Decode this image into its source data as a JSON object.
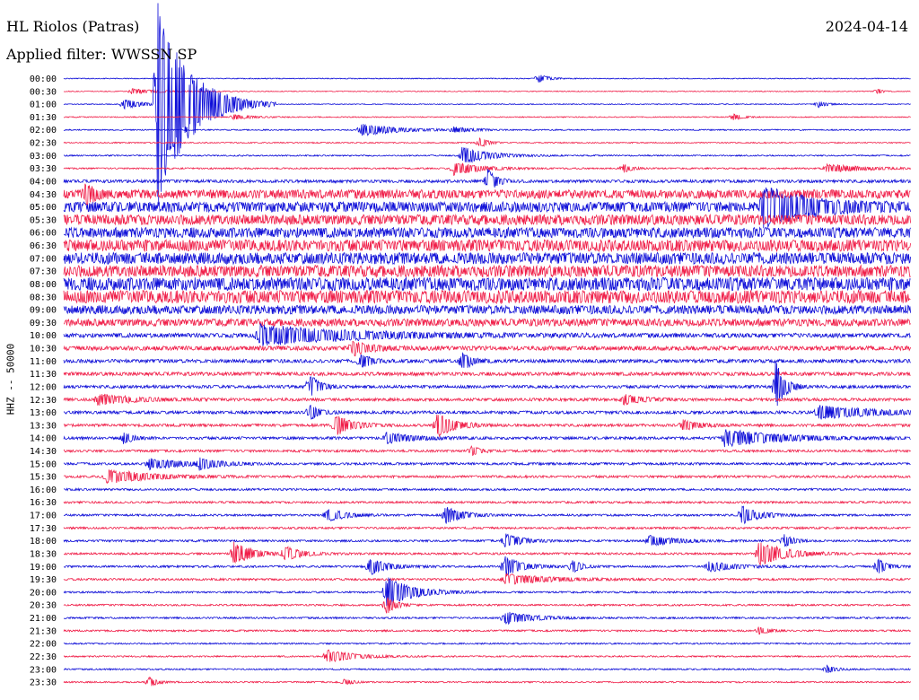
{
  "header": {
    "station": "HL Riolos (Patras)",
    "filter": "Applied filter: WWSSN SP",
    "date": "2024-04-14"
  },
  "chart_data": {
    "type": "line",
    "title": "HL Riolos (Patras)",
    "ylabel": "HHZ -- 50000",
    "xlabel": "",
    "grid": false,
    "row_times": [
      "00:00",
      "00:30",
      "01:00",
      "01:30",
      "02:00",
      "02:30",
      "03:00",
      "03:30",
      "04:00",
      "04:30",
      "05:00",
      "05:30",
      "06:00",
      "06:30",
      "07:00",
      "07:30",
      "08:00",
      "08:30",
      "09:00",
      "09:30",
      "10:00",
      "10:30",
      "11:00",
      "11:30",
      "12:00",
      "12:30",
      "13:00",
      "13:30",
      "14:00",
      "14:30",
      "15:00",
      "15:30",
      "16:00",
      "16:30",
      "17:00",
      "17:30",
      "18:00",
      "18:30",
      "19:00",
      "19:30",
      "20:00",
      "20:30",
      "21:00",
      "21:30",
      "22:00",
      "22:30",
      "23:00",
      "23:30"
    ],
    "colors": [
      "#1010d8",
      "#f0204a"
    ],
    "noise_level": [
      0.3,
      0.3,
      0.3,
      0.35,
      0.4,
      0.4,
      0.45,
      0.5,
      1.0,
      3.0,
      3.5,
      3.5,
      3.5,
      4.0,
      4.0,
      4.0,
      4.5,
      4.5,
      3.0,
      2.5,
      1.5,
      1.5,
      1.2,
      1.2,
      1.0,
      1.0,
      1.0,
      0.9,
      0.9,
      0.8,
      0.8,
      0.8,
      0.7,
      0.7,
      0.7,
      0.7,
      0.7,
      0.7,
      0.7,
      0.7,
      0.6,
      0.6,
      0.6,
      0.6,
      0.5,
      0.5,
      0.5,
      0.5
    ],
    "events": [
      {
        "row": 0,
        "t": 0.56,
        "amp": 6,
        "dur": 0.01
      },
      {
        "row": 1,
        "t": 0.08,
        "amp": 3,
        "dur": 0.03
      },
      {
        "row": 1,
        "t": 0.96,
        "amp": 4,
        "dur": 0.005
      },
      {
        "row": 2,
        "t": 0.07,
        "amp": 6,
        "dur": 0.02
      },
      {
        "row": 2,
        "t": 0.11,
        "amp": 120,
        "dur": 0.035
      },
      {
        "row": 2,
        "t": 0.89,
        "amp": 4,
        "dur": 0.01
      },
      {
        "row": 3,
        "t": 0.2,
        "amp": 3,
        "dur": 0.02
      },
      {
        "row": 3,
        "t": 0.79,
        "amp": 4,
        "dur": 0.01
      },
      {
        "row": 4,
        "t": 0.35,
        "amp": 7,
        "dur": 0.04
      },
      {
        "row": 4,
        "t": 0.46,
        "amp": 3,
        "dur": 0.02
      },
      {
        "row": 5,
        "t": 0.49,
        "amp": 6,
        "dur": 0.01
      },
      {
        "row": 6,
        "t": 0.47,
        "amp": 10,
        "dur": 0.03
      },
      {
        "row": 7,
        "t": 0.46,
        "amp": 8,
        "dur": 0.03
      },
      {
        "row": 7,
        "t": 0.66,
        "amp": 5,
        "dur": 0.01
      },
      {
        "row": 7,
        "t": 0.9,
        "amp": 5,
        "dur": 0.04
      },
      {
        "row": 8,
        "t": 0.5,
        "amp": 14,
        "dur": 0.01
      },
      {
        "row": 9,
        "t": 0.025,
        "amp": 14,
        "dur": 0.01
      },
      {
        "row": 10,
        "t": 0.825,
        "amp": 22,
        "dur": 0.05
      },
      {
        "row": 20,
        "t": 0.23,
        "amp": 12,
        "dur": 0.1
      },
      {
        "row": 21,
        "t": 0.34,
        "amp": 8,
        "dur": 0.02
      },
      {
        "row": 22,
        "t": 0.35,
        "amp": 10,
        "dur": 0.01
      },
      {
        "row": 22,
        "t": 0.47,
        "amp": 12,
        "dur": 0.01
      },
      {
        "row": 24,
        "t": 0.29,
        "amp": 16,
        "dur": 0.01
      },
      {
        "row": 24,
        "t": 0.84,
        "amp": 30,
        "dur": 0.01
      },
      {
        "row": 25,
        "t": 0.04,
        "amp": 6,
        "dur": 0.04
      },
      {
        "row": 25,
        "t": 0.66,
        "amp": 6,
        "dur": 0.02
      },
      {
        "row": 26,
        "t": 0.29,
        "amp": 10,
        "dur": 0.01
      },
      {
        "row": 26,
        "t": 0.89,
        "amp": 8,
        "dur": 0.06
      },
      {
        "row": 27,
        "t": 0.32,
        "amp": 12,
        "dur": 0.02
      },
      {
        "row": 27,
        "t": 0.44,
        "amp": 14,
        "dur": 0.02
      },
      {
        "row": 27,
        "t": 0.73,
        "amp": 6,
        "dur": 0.02
      },
      {
        "row": 28,
        "t": 0.07,
        "amp": 7,
        "dur": 0.01
      },
      {
        "row": 28,
        "t": 0.38,
        "amp": 6,
        "dur": 0.03
      },
      {
        "row": 28,
        "t": 0.78,
        "amp": 10,
        "dur": 0.06
      },
      {
        "row": 29,
        "t": 0.48,
        "amp": 6,
        "dur": 0.01
      },
      {
        "row": 30,
        "t": 0.1,
        "amp": 6,
        "dur": 0.04
      },
      {
        "row": 30,
        "t": 0.16,
        "amp": 6,
        "dur": 0.02
      },
      {
        "row": 31,
        "t": 0.05,
        "amp": 8,
        "dur": 0.05
      },
      {
        "row": 34,
        "t": 0.31,
        "amp": 8,
        "dur": 0.02
      },
      {
        "row": 34,
        "t": 0.45,
        "amp": 10,
        "dur": 0.02
      },
      {
        "row": 34,
        "t": 0.8,
        "amp": 10,
        "dur": 0.02
      },
      {
        "row": 36,
        "t": 0.52,
        "amp": 8,
        "dur": 0.02
      },
      {
        "row": 36,
        "t": 0.69,
        "amp": 6,
        "dur": 0.03
      },
      {
        "row": 36,
        "t": 0.85,
        "amp": 8,
        "dur": 0.01
      },
      {
        "row": 37,
        "t": 0.2,
        "amp": 14,
        "dur": 0.02
      },
      {
        "row": 37,
        "t": 0.26,
        "amp": 8,
        "dur": 0.02
      },
      {
        "row": 37,
        "t": 0.82,
        "amp": 14,
        "dur": 0.03
      },
      {
        "row": 38,
        "t": 0.36,
        "amp": 10,
        "dur": 0.02
      },
      {
        "row": 38,
        "t": 0.52,
        "amp": 12,
        "dur": 0.02
      },
      {
        "row": 38,
        "t": 0.6,
        "amp": 8,
        "dur": 0.01
      },
      {
        "row": 38,
        "t": 0.76,
        "amp": 6,
        "dur": 0.03
      },
      {
        "row": 38,
        "t": 0.96,
        "amp": 10,
        "dur": 0.01
      },
      {
        "row": 39,
        "t": 0.52,
        "amp": 6,
        "dur": 0.05
      },
      {
        "row": 40,
        "t": 0.38,
        "amp": 18,
        "dur": 0.03
      },
      {
        "row": 41,
        "t": 0.38,
        "amp": 12,
        "dur": 0.01
      },
      {
        "row": 42,
        "t": 0.52,
        "amp": 8,
        "dur": 0.03
      },
      {
        "row": 43,
        "t": 0.82,
        "amp": 5,
        "dur": 0.01
      },
      {
        "row": 45,
        "t": 0.31,
        "amp": 8,
        "dur": 0.03
      },
      {
        "row": 46,
        "t": 0.9,
        "amp": 5,
        "dur": 0.01
      },
      {
        "row": 47,
        "t": 0.1,
        "amp": 6,
        "dur": 0.01
      },
      {
        "row": 47,
        "t": 0.33,
        "amp": 4,
        "dur": 0.01
      }
    ]
  }
}
